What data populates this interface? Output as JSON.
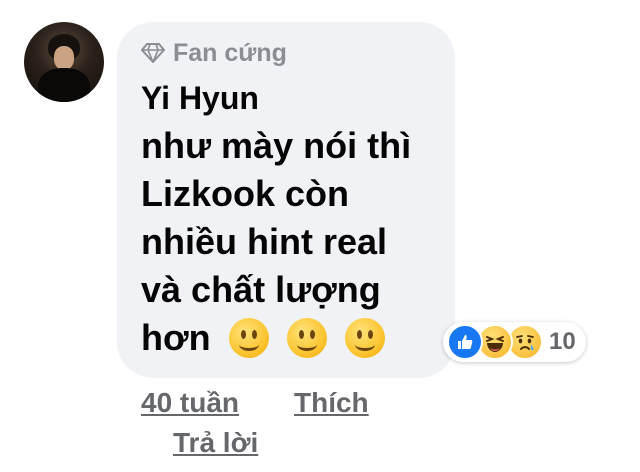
{
  "comment": {
    "badge": {
      "icon": "diamond-icon",
      "label": "Fan cứng"
    },
    "author": "Yi Hyun",
    "text_lines": [
      "như mày nói thì",
      "Lizkook còn",
      "nhiều hint real",
      "và chất lượng",
      "hơn"
    ],
    "trailing_emojis": [
      "slightly-smiling-face",
      "slightly-smiling-face",
      "slightly-smiling-face"
    ],
    "reactions": {
      "icons": [
        "like-icon",
        "haha-icon",
        "sad-icon"
      ],
      "count": "10"
    },
    "actions": {
      "time": "40 tuần",
      "like": "Thích",
      "reply": "Trả lời"
    }
  },
  "colors": {
    "bubble_bg": "#f0f2f5",
    "text": "#050505",
    "secondary_text": "#65676b",
    "badge_text": "#8a8d91",
    "like_blue": "#1877f2"
  }
}
